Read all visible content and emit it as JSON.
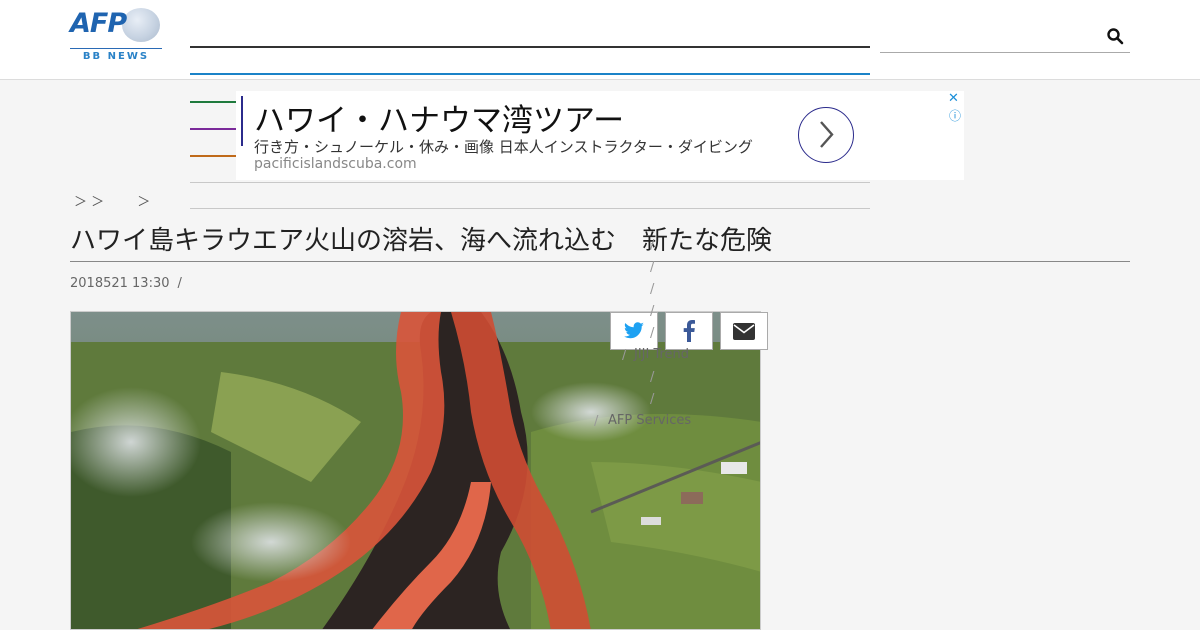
{
  "header": {
    "logo": {
      "brand": "AFP",
      "sub": "BB NEWS"
    },
    "search": {
      "placeholder": "",
      "icon": "search-icon"
    }
  },
  "ad": {
    "title": "ハワイ・ハナウマ湾ツアー",
    "description": "行き方・シュノーケル・休み・画像 日本人インストラクター・ダイビング",
    "url": "pacificislandscuba.com",
    "close_glyph": "✕",
    "info_glyph": "ⓘ"
  },
  "breadcrumb": {
    "text": "＞ ＞        ＞"
  },
  "article": {
    "title": "ハワイ島キラウエア火山の溶岩、海へ流れ込む　新たな危険",
    "meta": {
      "date": "2018521 13:30",
      "separator": "/"
    }
  },
  "share": {
    "twitter_icon": "twitter-icon",
    "facebook_icon": "facebook-icon",
    "mail_icon": "mail-icon"
  },
  "sidebar": {
    "slashes": [
      "/",
      "/",
      "/",
      "/",
      "/",
      "/",
      "/",
      "/"
    ],
    "links": [
      "JIJI Trend",
      "AFP Services"
    ]
  },
  "colors": {
    "accent_blue": "#1b83c8",
    "ad_purple": "#2b2b8c",
    "green": "#1f7a3d",
    "violet": "#7b2a9a",
    "orange": "#c06a1a"
  }
}
